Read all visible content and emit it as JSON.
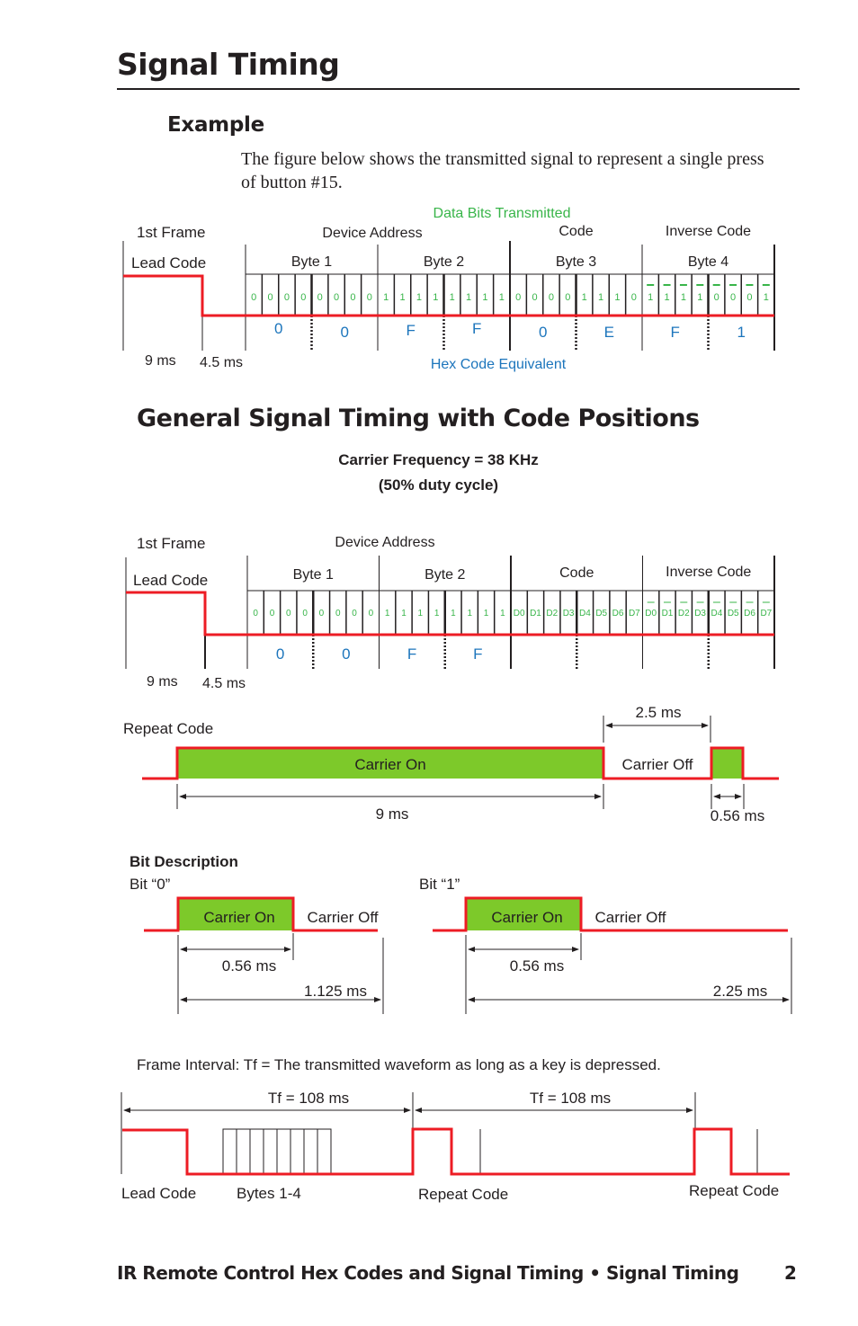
{
  "page": {
    "title": "Signal Timing",
    "example_heading": "Example",
    "example_text": "The figure below shows the transmitted signal to represent a single press of button #15.",
    "general_heading": "General Signal Timing with Code Positions",
    "carrier_line1": "Carrier Frequency = 38 KHz",
    "carrier_line2": "(50% duty cycle)",
    "footer": "IR Remote Control Hex Codes and Signal Timing • Signal Timing",
    "page_number": "2"
  },
  "colors": {
    "signal": "#ed1c24",
    "bits": "#39b54a",
    "hex": "#1c75bc",
    "carrier_fill": "#7dc92a",
    "ink": "#231f20"
  },
  "example_diagram": {
    "data_bits_label": "Data Bits Transmitted",
    "frame_label": "1st Frame",
    "lead_code_label": "Lead Code",
    "device_address_label": "Device Address",
    "code_label": "Code",
    "inverse_code_label": "Inverse Code",
    "bytes": [
      "Byte 1",
      "Byte 2",
      "Byte 3",
      "Byte 4"
    ],
    "bits": [
      "0",
      "0",
      "0",
      "0",
      "0",
      "0",
      "0",
      "0",
      "1",
      "1",
      "1",
      "1",
      "1",
      "1",
      "1",
      "1",
      "0",
      "0",
      "0",
      "0",
      "1",
      "1",
      "1",
      "0",
      "1",
      "1",
      "1",
      "1",
      "0",
      "0",
      "0",
      "1"
    ],
    "inverted_from_bit": 24,
    "hex": [
      "0",
      "0",
      "F",
      "F",
      "0",
      "E",
      "F",
      "1"
    ],
    "hex_label": "Hex Code Equivalent",
    "lead_high": "9 ms",
    "lead_low": "4.5 ms"
  },
  "general_diagram": {
    "frame_label": "1st Frame",
    "lead_code_label": "Lead Code",
    "device_address_label": "Device Address",
    "code_label": "Code",
    "inverse_code_label": "Inverse Code",
    "bytes": [
      "Byte 1",
      "Byte 2"
    ],
    "bits": [
      "0",
      "0",
      "0",
      "0",
      "0",
      "0",
      "0",
      "0",
      "1",
      "1",
      "1",
      "1",
      "1",
      "1",
      "1",
      "1",
      "D0",
      "D1",
      "D2",
      "D3",
      "D4",
      "D5",
      "D6",
      "D7",
      "D0",
      "D1",
      "D2",
      "D3",
      "D4",
      "D5",
      "D6",
      "D7"
    ],
    "inverted_from_bit": 24,
    "hex": [
      "0",
      "0",
      "F",
      "F"
    ],
    "lead_high": "9 ms",
    "lead_low": "4.5 ms"
  },
  "repeat_code": {
    "label": "Repeat Code",
    "carrier_on": "Carrier On",
    "carrier_off": "Carrier Off",
    "on_duration": "9 ms",
    "off_duration": "2.5 ms",
    "pulse_duration": "0.56 ms"
  },
  "bit_description": {
    "heading": "Bit Description",
    "bits": [
      {
        "label": "Bit “0”",
        "carrier_on": "Carrier On",
        "carrier_off": "Carrier Off",
        "on_duration": "0.56 ms",
        "period": "1.125 ms"
      },
      {
        "label": "Bit “1”",
        "carrier_on": "Carrier On",
        "carrier_off": "Carrier Off",
        "on_duration": "0.56 ms",
        "period": "2.25 ms"
      }
    ]
  },
  "frame_interval": {
    "caption": "Frame Interval: Tf = The transmitted waveform as long as a key is depressed.",
    "tf1": "Tf = 108 ms",
    "tf2": "Tf = 108 ms",
    "lead_code": "Lead Code",
    "bytes": "Bytes 1-4",
    "repeat1": "Repeat Code",
    "repeat2": "Repeat Code"
  }
}
